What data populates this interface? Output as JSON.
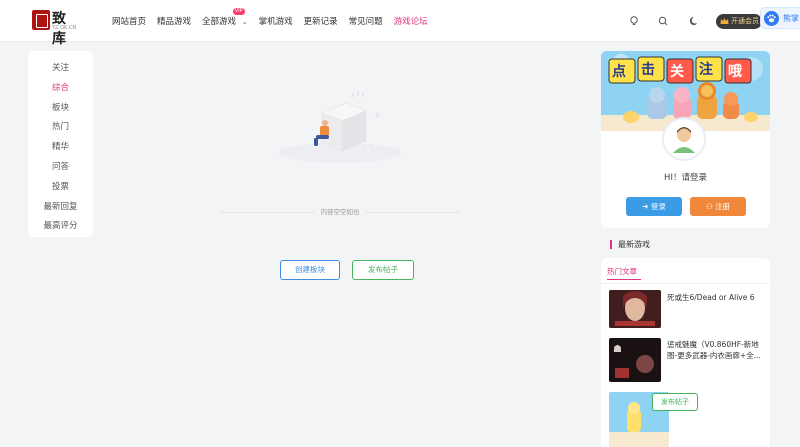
{
  "header": {
    "logo_text": "致库",
    "logo_sub": "YZ.OK.CN",
    "nav": [
      {
        "label": "网站首页"
      },
      {
        "label": "精品游戏"
      },
      {
        "label": "全部游戏",
        "badge": "VIP"
      },
      {
        "label": "掌机游戏"
      },
      {
        "label": "更新记录"
      },
      {
        "label": "常见问题"
      },
      {
        "label": "游戏论坛"
      }
    ],
    "vip_button": "开通会员",
    "baidu_label": "熊掌号"
  },
  "sidebar": {
    "items": [
      {
        "label": "关注"
      },
      {
        "label": "综合"
      },
      {
        "label": "板块"
      },
      {
        "label": "热门"
      },
      {
        "label": "精华"
      },
      {
        "label": "问答"
      },
      {
        "label": "投票"
      },
      {
        "label": "最新回复"
      },
      {
        "label": "最高评分"
      }
    ],
    "active_index": 1
  },
  "main": {
    "empty_text": "内容空空如也",
    "create_board_button": "创建板块",
    "post_button": "发布帖子"
  },
  "login": {
    "banner_text": "点击关注哦",
    "greeting": "HI！请登录",
    "login_button": "登录",
    "register_button": "注册"
  },
  "latest": {
    "title": "最新游戏"
  },
  "hot": {
    "tab_label": "热门文章",
    "articles": [
      {
        "title": "死或生6/Dead or Alive 6"
      },
      {
        "title_line1": "惩戒魅魔（V0.860HF-新地",
        "title_line2": "图-更多武器-内衣画廊+全..."
      }
    ],
    "floating_post_button": "发布帖子"
  },
  "colors": {
    "accent": "#e0357f",
    "blue": "#3b9be5",
    "orange": "#f0873a",
    "green": "#45b25c"
  }
}
